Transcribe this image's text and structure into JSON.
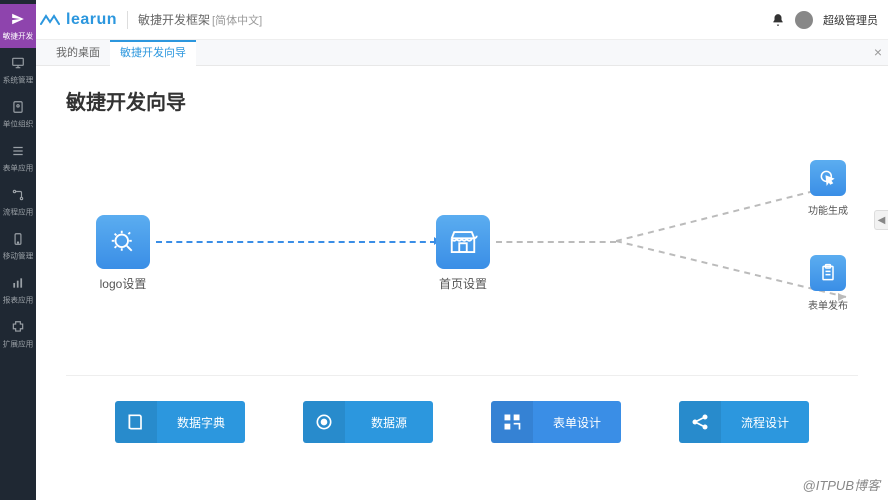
{
  "header": {
    "logo_text": "learun",
    "title": "敏捷开发框架",
    "sub": "[简体中文]",
    "user_name": "超级管理员"
  },
  "sidebar": {
    "items": [
      {
        "label": "敏捷开发",
        "icon": "plane"
      },
      {
        "label": "系统管理",
        "icon": "monitor"
      },
      {
        "label": "单位组织",
        "icon": "badge"
      },
      {
        "label": "表单应用",
        "icon": "list"
      },
      {
        "label": "流程应用",
        "icon": "flow"
      },
      {
        "label": "移动管理",
        "icon": "mobile"
      },
      {
        "label": "报表应用",
        "icon": "chart"
      },
      {
        "label": "扩展应用",
        "icon": "puzzle"
      }
    ]
  },
  "tabs": {
    "items": [
      {
        "label": "我的桌面",
        "active": false
      },
      {
        "label": "敏捷开发向导",
        "active": true
      }
    ]
  },
  "page": {
    "title": "敏捷开发向导",
    "flow_nodes": {
      "logo": "logo设置",
      "home": "首页设置",
      "gen": "功能生成",
      "pub": "表单发布"
    },
    "actions": [
      {
        "label": "数据字典",
        "icon": "book"
      },
      {
        "label": "数据源",
        "icon": "target"
      },
      {
        "label": "表单设计",
        "icon": "blocks"
      },
      {
        "label": "流程设计",
        "icon": "share"
      }
    ]
  },
  "watermark": "@ITPUB博客"
}
